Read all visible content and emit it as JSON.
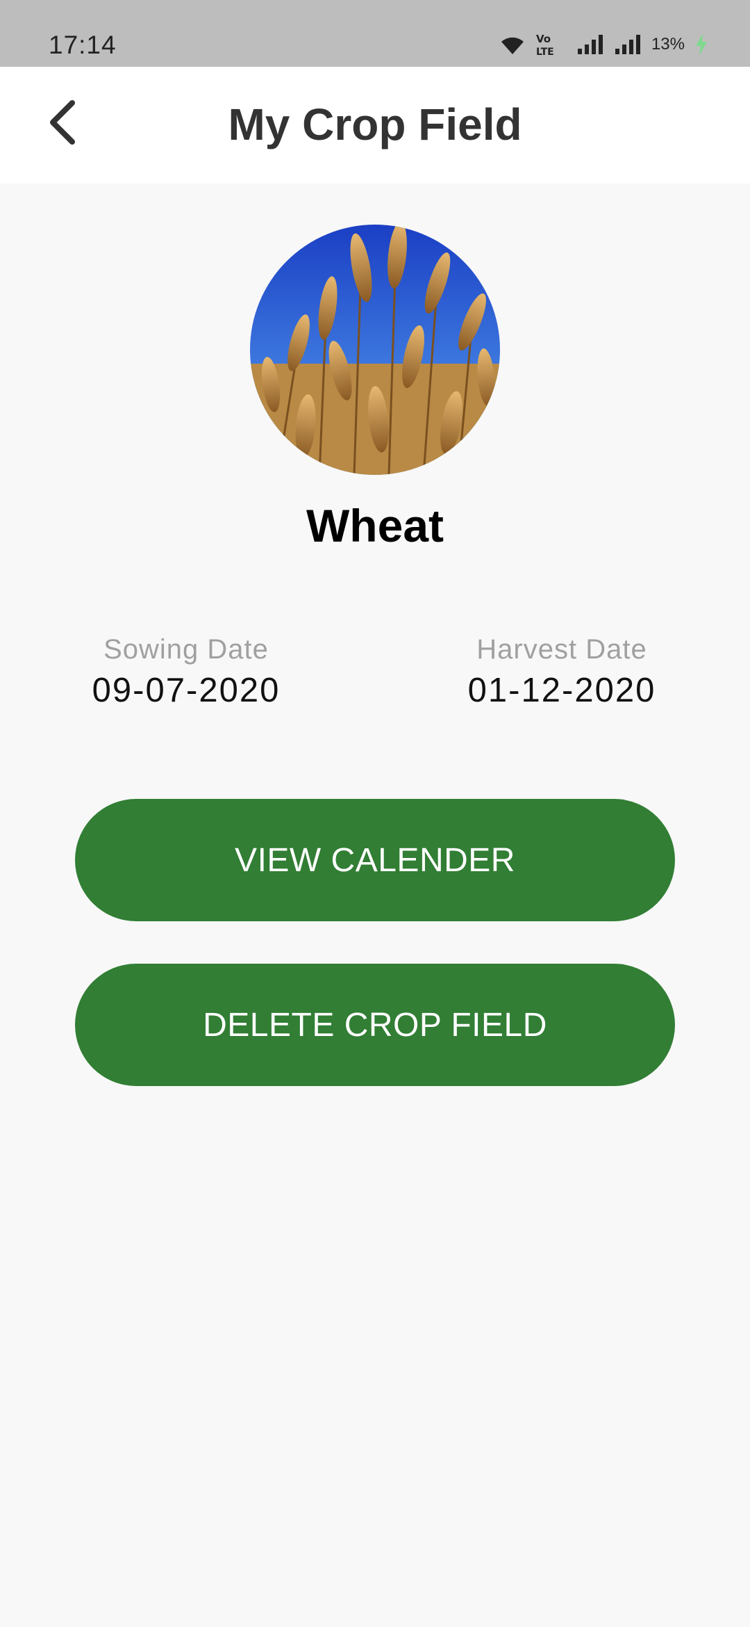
{
  "status_bar": {
    "time": "17:14",
    "battery": "13%",
    "icons": [
      "wifi-icon",
      "volte-icon",
      "signal-icon",
      "signal-icon",
      "charging-icon"
    ]
  },
  "header": {
    "title": "My Crop Field",
    "back_icon": "chevron-left-icon"
  },
  "crop": {
    "name": "Wheat",
    "image": "wheat-field-photo"
  },
  "dates": {
    "sowing_label": "Sowing Date",
    "sowing_value": "09-07-2020",
    "harvest_label": "Harvest Date",
    "harvest_value": "01-12-2020"
  },
  "actions": {
    "view_calendar": "VIEW CALENDER",
    "delete_field": "DELETE CROP FIELD"
  },
  "colors": {
    "primary_green": "#317e34",
    "status_bar": "#bdbdbd",
    "background": "#f8f8f8"
  }
}
